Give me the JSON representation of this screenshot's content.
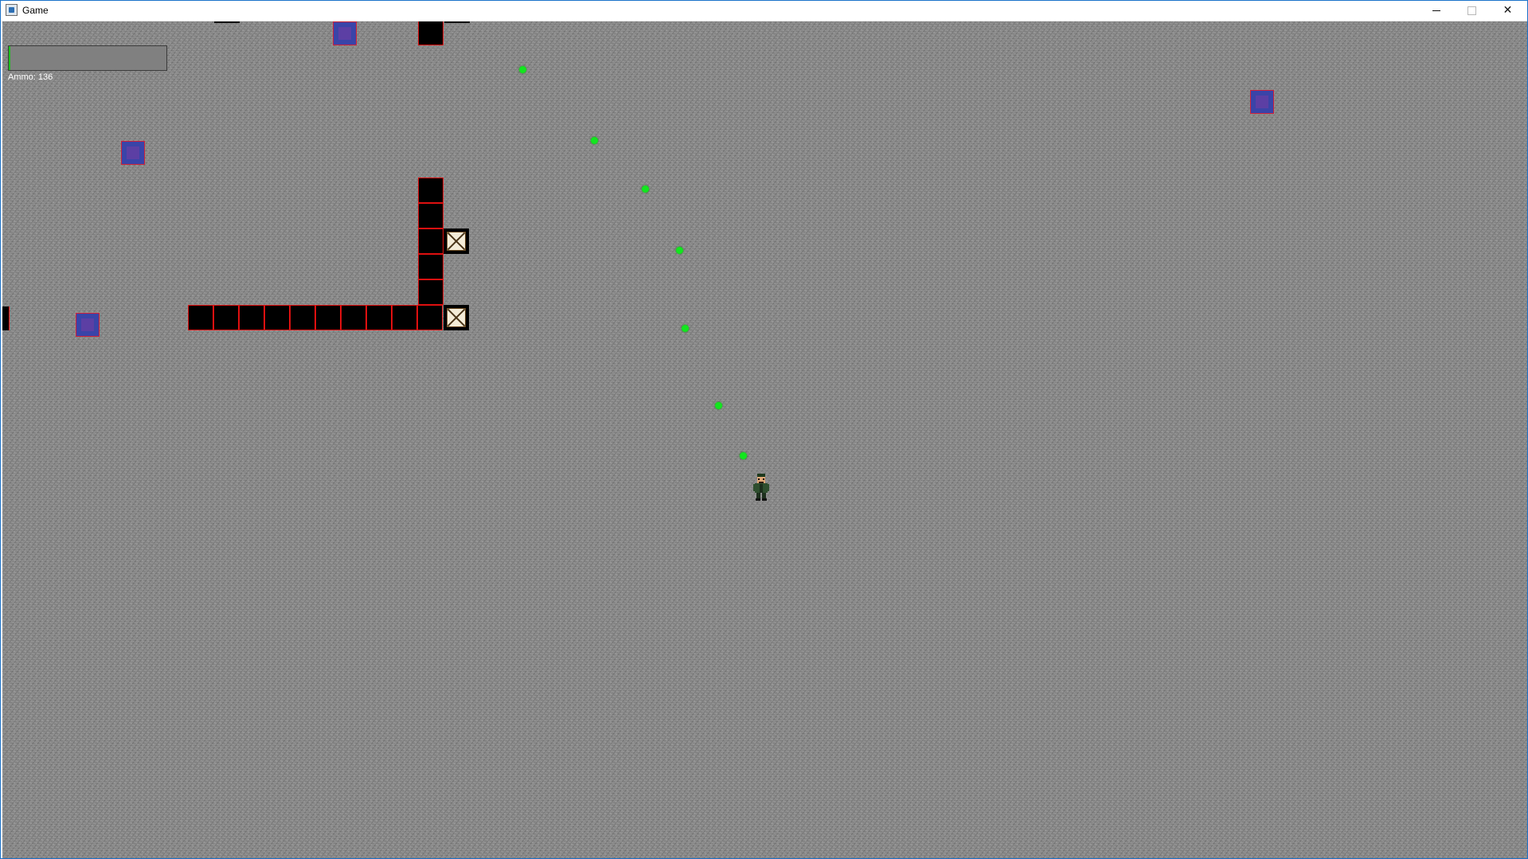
{
  "window": {
    "title": "Game",
    "controls": {
      "minimize": "minimize-icon",
      "maximize": "maximize-icon",
      "close": "close-icon"
    }
  },
  "hud": {
    "health_fraction": 0.01,
    "ammo_text": "Ammo: 136"
  },
  "colors": {
    "wall_fill": "#000000",
    "wall_border": "#e01010",
    "enemy_fill": "#3a44a8",
    "bullet": "#12e61e",
    "ground": "#8a8a8a"
  },
  "sprites": {
    "player": "soldier-icon",
    "wall": "wall-block",
    "crate": "crate-icon",
    "enemy": "enemy-box",
    "bullet": "bullet"
  }
}
